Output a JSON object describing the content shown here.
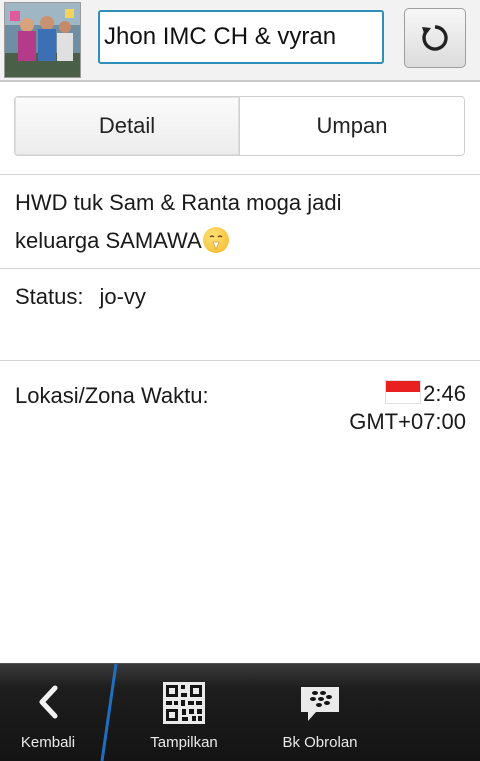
{
  "header": {
    "contact_name": "Jhon IMC CH & vyran"
  },
  "tabs": [
    {
      "label": "Detail",
      "active": true
    },
    {
      "label": "Umpan",
      "active": false
    }
  ],
  "message": {
    "line1": "HWD tuk Sam & Ranta moga jadi",
    "line2": "keluarga SAMAWA"
  },
  "status": {
    "label": "Status:",
    "value": "jo-vy"
  },
  "location": {
    "label": "Lokasi/Zona Waktu:",
    "time": "2:46",
    "zone": "GMT+07:00"
  },
  "bottom_bar": {
    "back_label": "Kembali",
    "show_label": "Tampilkan",
    "bbm_label": "Bk Obrolan"
  },
  "colors": {
    "accent": "#2f8fb8",
    "bar_bg": "#141414"
  }
}
